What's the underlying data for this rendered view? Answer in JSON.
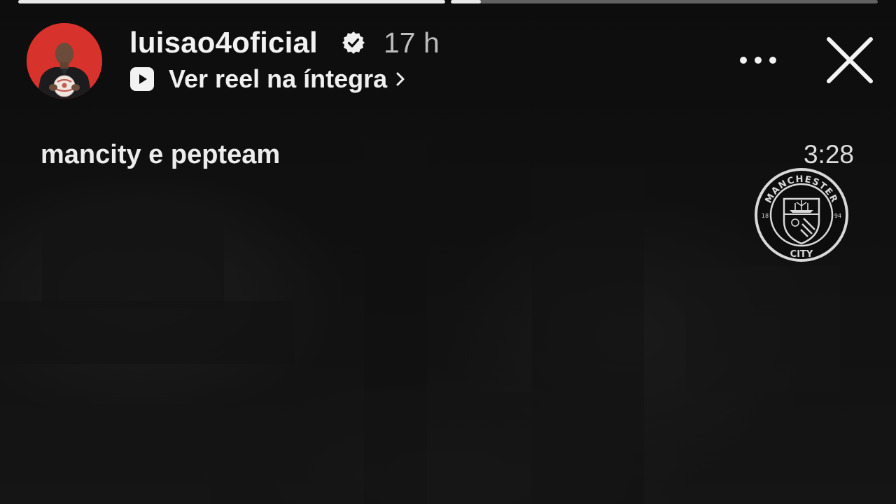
{
  "progress": {
    "segments": [
      {
        "fill": 1.0
      },
      {
        "fill": 0.07
      }
    ]
  },
  "header": {
    "username": "luisao4oficial",
    "time_ago": "17 h",
    "reel_link_label": "Ver reel na íntegra"
  },
  "overlay": {
    "caption": "mancity e pepteam",
    "clock": "3:28",
    "crest": {
      "top_text": "MANCHESTER",
      "bottom_text": "CITY",
      "year_left": "18",
      "year_right": "94"
    }
  },
  "colors": {
    "avatar_bg": "#d8322c",
    "background": "#0b0b0b",
    "text": "#f2f2f2",
    "muted": "#bdbdbd"
  },
  "icons": {
    "verified": "verified-badge-icon",
    "play": "reel-play-icon",
    "more": "more-dots-icon",
    "close": "close-x-icon",
    "chevron": "chevron-right-icon"
  }
}
